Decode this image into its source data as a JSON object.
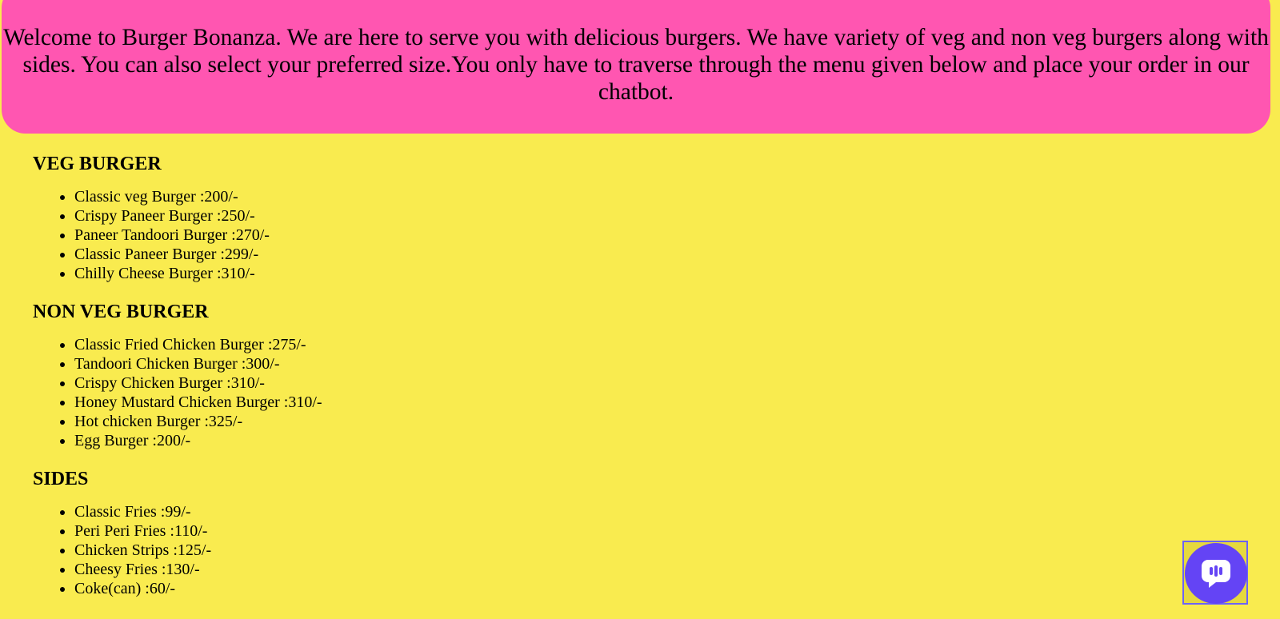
{
  "banner": {
    "text": "Welcome to Burger Bonanza. We are here to serve you with delicious burgers. We have variety of veg and non veg burgers along with sides. You can also select your preferred size.You only have to traverse through the menu given below and place your order in our chatbot."
  },
  "menu": {
    "veg": {
      "title": "VEG BURGER",
      "items": [
        "Classic veg Burger :200/-",
        "Crispy Paneer Burger :250/-",
        "Paneer Tandoori Burger :270/-",
        "Classic Paneer Burger :299/-",
        "Chilly Cheese Burger :310/-"
      ]
    },
    "nonveg": {
      "title": "NON VEG BURGER",
      "items": [
        "Classic Fried Chicken Burger :275/-",
        "Tandoori Chicken Burger :300/-",
        "Crispy Chicken Burger :310/-",
        "Honey Mustard Chicken Burger :310/-",
        "Hot chicken Burger :325/-",
        "Egg Burger :200/-"
      ]
    },
    "sides": {
      "title": "SIDES",
      "items": [
        "Classic Fries :99/-",
        "Peri Peri Fries :110/-",
        "Chicken Strips :125/-",
        "Cheesy Fries :130/-",
        "Coke(can) :60/-"
      ]
    }
  },
  "chat_widget": {
    "icon": "chat-bubble-icon",
    "accent_color": "#6444f5"
  },
  "colors": {
    "page_background": "#f9eb4f",
    "banner_background": "#ff56b1"
  }
}
